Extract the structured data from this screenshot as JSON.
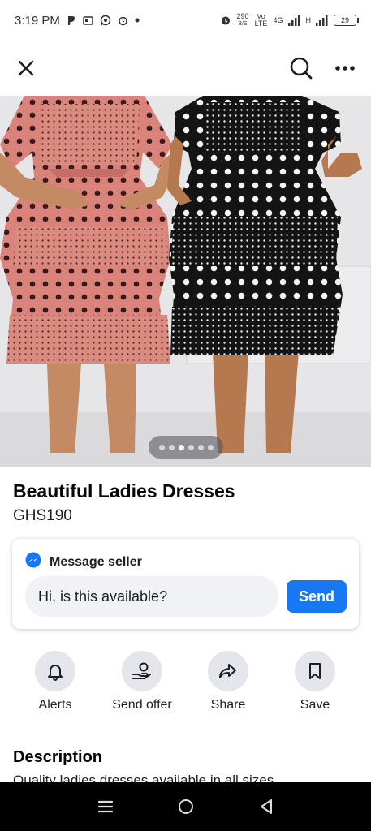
{
  "status_bar": {
    "time": "3:19 PM",
    "network_speed": "290",
    "network_unit": "B/S",
    "volte": "Vo LTE",
    "network_type": "4G",
    "signal_label": "H",
    "battery": "29"
  },
  "top_bar": {
    "close_icon": "close-icon",
    "search_icon": "search-icon",
    "more_icon": "more-icon"
  },
  "carousel": {
    "total": 6,
    "active_index": 2
  },
  "listing": {
    "title": "Beautiful Ladies Dresses",
    "price": "GHS190"
  },
  "message": {
    "header": "Message seller",
    "input_value": "Hi, is this available?",
    "send_label": "Send"
  },
  "actions": [
    {
      "label": "Alerts",
      "icon": "bell-icon"
    },
    {
      "label": "Send offer",
      "icon": "offer-icon"
    },
    {
      "label": "Share",
      "icon": "share-icon"
    },
    {
      "label": "Save",
      "icon": "bookmark-icon"
    }
  ],
  "description": {
    "title": "Description",
    "text": "Quality ladies dresses available in all sizes"
  },
  "colors": {
    "accent": "#1877f2",
    "dress_pink": "#d9837a",
    "dress_black": "#1a1a1a"
  }
}
